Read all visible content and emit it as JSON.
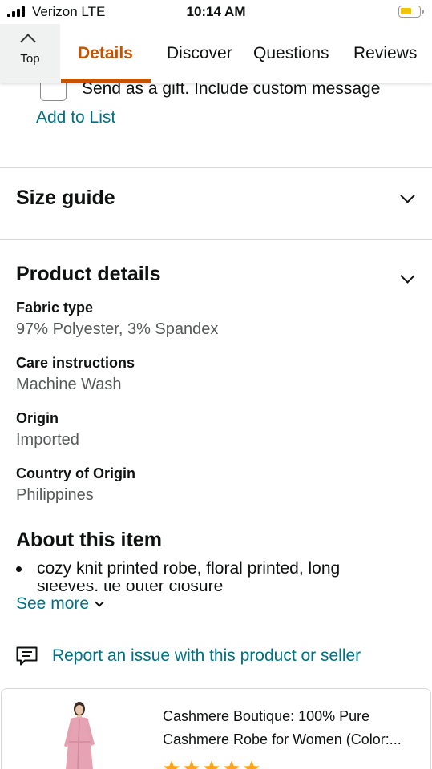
{
  "status_bar": {
    "carrier": "Verizon  LTE",
    "time": "10:14 AM"
  },
  "nav": {
    "top_label": "Top",
    "tabs": [
      {
        "label": "Details",
        "active": true
      },
      {
        "label": "Discover",
        "active": false
      },
      {
        "label": "Questions",
        "active": false
      },
      {
        "label": "Reviews",
        "active": false
      }
    ]
  },
  "gift": {
    "label": "Send as a gift. Include custom message",
    "checked": false
  },
  "add_to_list": "Add to List",
  "size_guide": {
    "title": "Size guide"
  },
  "product_details": {
    "title": "Product details",
    "items": [
      {
        "label": "Fabric type",
        "value": "97% Polyester, 3% Spandex"
      },
      {
        "label": "Care instructions",
        "value": "Machine Wash"
      },
      {
        "label": "Origin",
        "value": "Imported"
      },
      {
        "label": "Country of Origin",
        "value": "Philippines"
      }
    ]
  },
  "about": {
    "title": "About this item",
    "bullet": "cozy knit printed robe, floral printed, long",
    "bullet_cut": "sleeves, tie outer closure",
    "see_more": "See more"
  },
  "report": {
    "label": "Report an issue with this product or seller",
    "icon": "report-message-icon"
  },
  "recommendation": {
    "title": "Cashmere Boutique: 100% Pure Cashmere Robe for Women (Color:...",
    "image": "woman-in-pink-robe",
    "stars": 5
  },
  "colors": {
    "accent": "#c45500",
    "link": "#007185",
    "text": "#0f1111",
    "secondary_text": "#565959",
    "divider": "#d5d9d9",
    "star": "#ffa41c",
    "battery": "#f5c400"
  }
}
